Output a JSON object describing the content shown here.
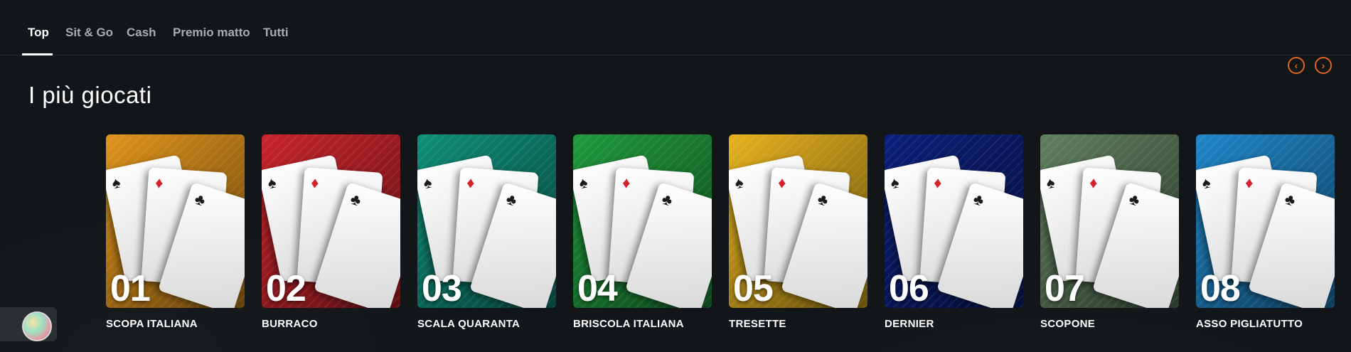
{
  "tabs": [
    {
      "label": "Top",
      "active": true
    },
    {
      "label": "Sit & Go",
      "active": false
    },
    {
      "label": "Cash",
      "active": false
    },
    {
      "label": "Premio matto",
      "active": false
    },
    {
      "label": "Tutti",
      "active": false
    }
  ],
  "carousel": {
    "prev_icon": "chevron-left-icon",
    "next_icon": "chevron-right-icon",
    "accent_color": "#e0651e"
  },
  "section": {
    "title": "I più giocati"
  },
  "games": [
    {
      "rank": "01",
      "name": "SCOPA ITALIANA",
      "color": "#e0931a"
    },
    {
      "rank": "02",
      "name": "BURRACO",
      "color": "#c9242b"
    },
    {
      "rank": "03",
      "name": "SCALA QUARANTA",
      "color": "#0e8f7a"
    },
    {
      "rank": "04",
      "name": "BRISCOLA ITALIANA",
      "color": "#1f9a3c"
    },
    {
      "rank": "05",
      "name": "TRESETTE",
      "color": "#e6b21d"
    },
    {
      "rank": "06",
      "name": "DERNIER",
      "color": "#0b1f7a"
    },
    {
      "rank": "07",
      "name": "SCOPONE",
      "color": "#5f7f5e"
    },
    {
      "rank": "08",
      "name": "ASSO PIGLIATUTTO",
      "color": "#1e86c9"
    }
  ],
  "chat_widget": {
    "icon": "chat-orb-icon"
  }
}
